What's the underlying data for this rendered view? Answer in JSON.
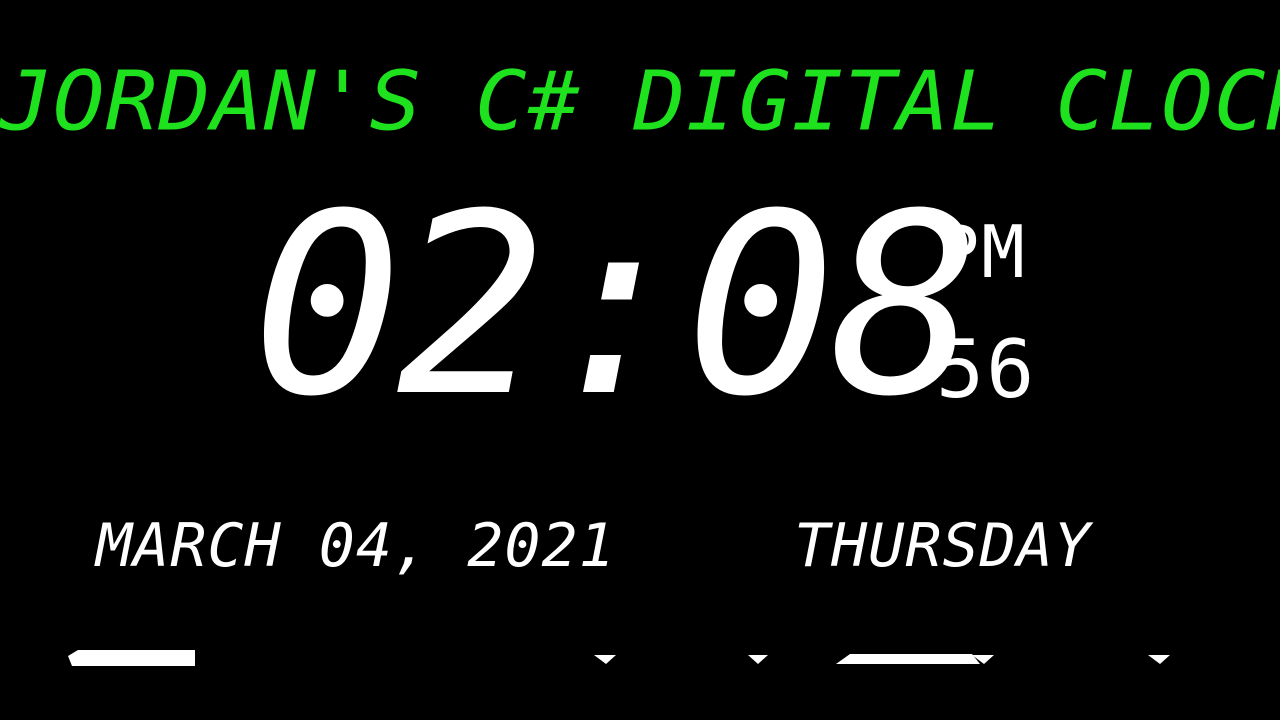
{
  "app": {
    "title": "JORDAN'S C# DIGITAL CLOCK"
  },
  "clock": {
    "time": "02:08",
    "ampm": "PM",
    "seconds": "56",
    "date": "MARCH 04, 2021",
    "weekday": "THURSDAY"
  },
  "colors": {
    "background": "#000000",
    "title": "#1fe21f",
    "digits": "#ffffff"
  }
}
